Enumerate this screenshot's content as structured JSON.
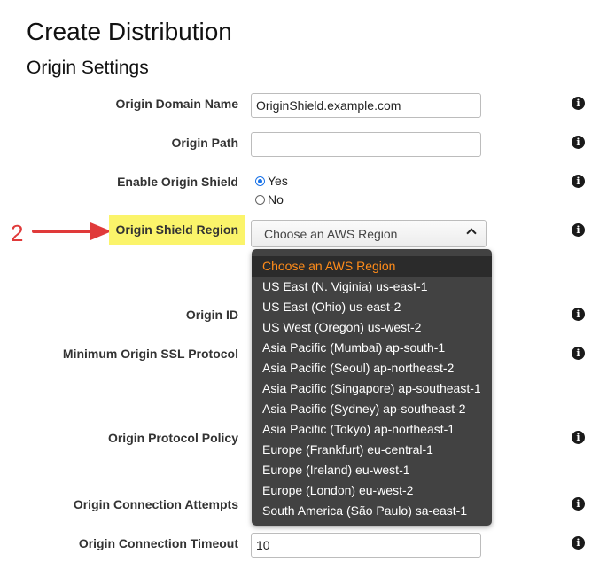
{
  "page": {
    "title": "Create Distribution",
    "section": "Origin Settings"
  },
  "fields": {
    "origin_domain_name": {
      "label": "Origin Domain Name",
      "value": "OriginShield.example.com"
    },
    "origin_path": {
      "label": "Origin Path",
      "value": ""
    },
    "enable_origin_shield": {
      "label": "Enable Origin Shield",
      "options": [
        "Yes",
        "No"
      ],
      "selected": "Yes"
    },
    "origin_shield_region": {
      "label": "Origin Shield Region",
      "value": "Choose an AWS Region"
    },
    "origin_id": {
      "label": "Origin ID"
    },
    "minimum_origin_ssl_protocol": {
      "label": "Minimum Origin SSL Protocol"
    },
    "origin_protocol_policy": {
      "label": "Origin Protocol Policy"
    },
    "origin_connection_attempts": {
      "label": "Origin Connection Attempts"
    },
    "origin_connection_timeout": {
      "label": "Origin Connection Timeout",
      "value": "10"
    }
  },
  "dropdown": {
    "items": [
      "Choose an AWS Region",
      "US East (N. Viginia) us-east-1",
      "US East (Ohio) us-east-2",
      "US West (Oregon) us-west-2",
      "Asia Pacific (Mumbai) ap-south-1",
      "Asia Pacific (Seoul) ap-northeast-2",
      "Asia Pacific (Singapore) ap-southeast-1",
      "Asia Pacific (Sydney) ap-southeast-2",
      "Asia Pacific (Tokyo) ap-northeast-1",
      "Europe (Frankfurt) eu-central-1",
      "Europe (Ireland) eu-west-1",
      "Europe (London) eu-west-2",
      "South America (São Paulo) sa-east-1"
    ]
  },
  "annotation": {
    "step": "2"
  },
  "icons": {
    "info": "info-icon",
    "arrow": "arrow-right-icon"
  },
  "colors": {
    "highlight": "#fbf46a",
    "annotation": "#e03a3a",
    "dropdown_bg": "#424242",
    "selected_text": "#ff8c1a"
  }
}
